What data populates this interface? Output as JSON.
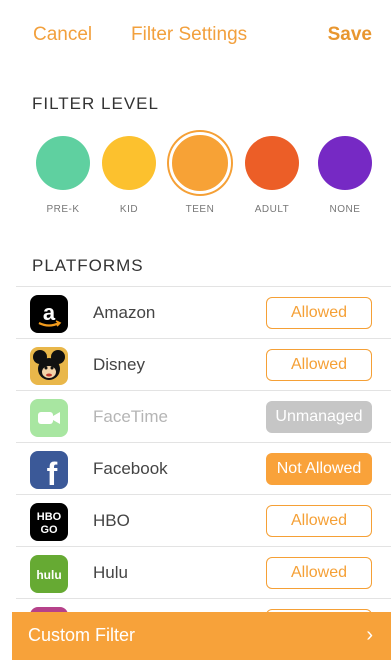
{
  "header": {
    "cancel": "Cancel",
    "title": "Filter Settings",
    "save": "Save"
  },
  "filter_level": {
    "title": "FILTER LEVEL",
    "levels": [
      {
        "label": "PRE-K",
        "color": "#5fd0a0"
      },
      {
        "label": "KID",
        "color": "#fcc12e"
      },
      {
        "label": "TEEN",
        "color": "#f7a236",
        "selected": true
      },
      {
        "label": "ADULT",
        "color": "#ec5e27"
      },
      {
        "label": "NONE",
        "color": "#7629c4"
      }
    ]
  },
  "platforms": {
    "title": "PLATFORMS",
    "items": [
      {
        "name": "Amazon",
        "icon": "amazon-icon",
        "status": "Allowed"
      },
      {
        "name": "Disney",
        "icon": "disney-icon",
        "status": "Allowed"
      },
      {
        "name": "FaceTime",
        "icon": "facetime-icon",
        "status": "Unmanaged"
      },
      {
        "name": "Facebook",
        "icon": "facebook-icon",
        "status": "Not Allowed"
      },
      {
        "name": "HBO",
        "icon": "hbo-go-icon",
        "status": "Allowed"
      },
      {
        "name": "Hulu",
        "icon": "hulu-icon",
        "status": "Allowed"
      }
    ]
  },
  "bottom": {
    "label": "Custom Filter"
  },
  "colors": {
    "accent": "#f5a036"
  }
}
